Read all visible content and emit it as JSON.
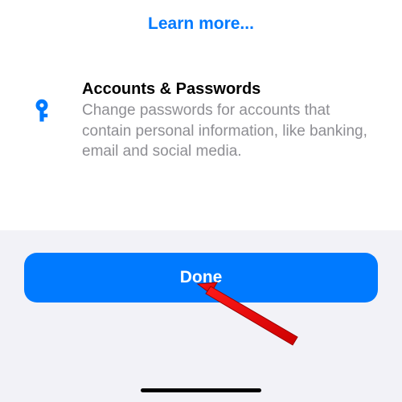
{
  "header": {
    "learn_more": "Learn more..."
  },
  "card": {
    "title": "Accounts & Passwords",
    "description": "Change passwords for accounts that contain personal information, like banking, email and social media."
  },
  "footer": {
    "done_label": "Done"
  }
}
